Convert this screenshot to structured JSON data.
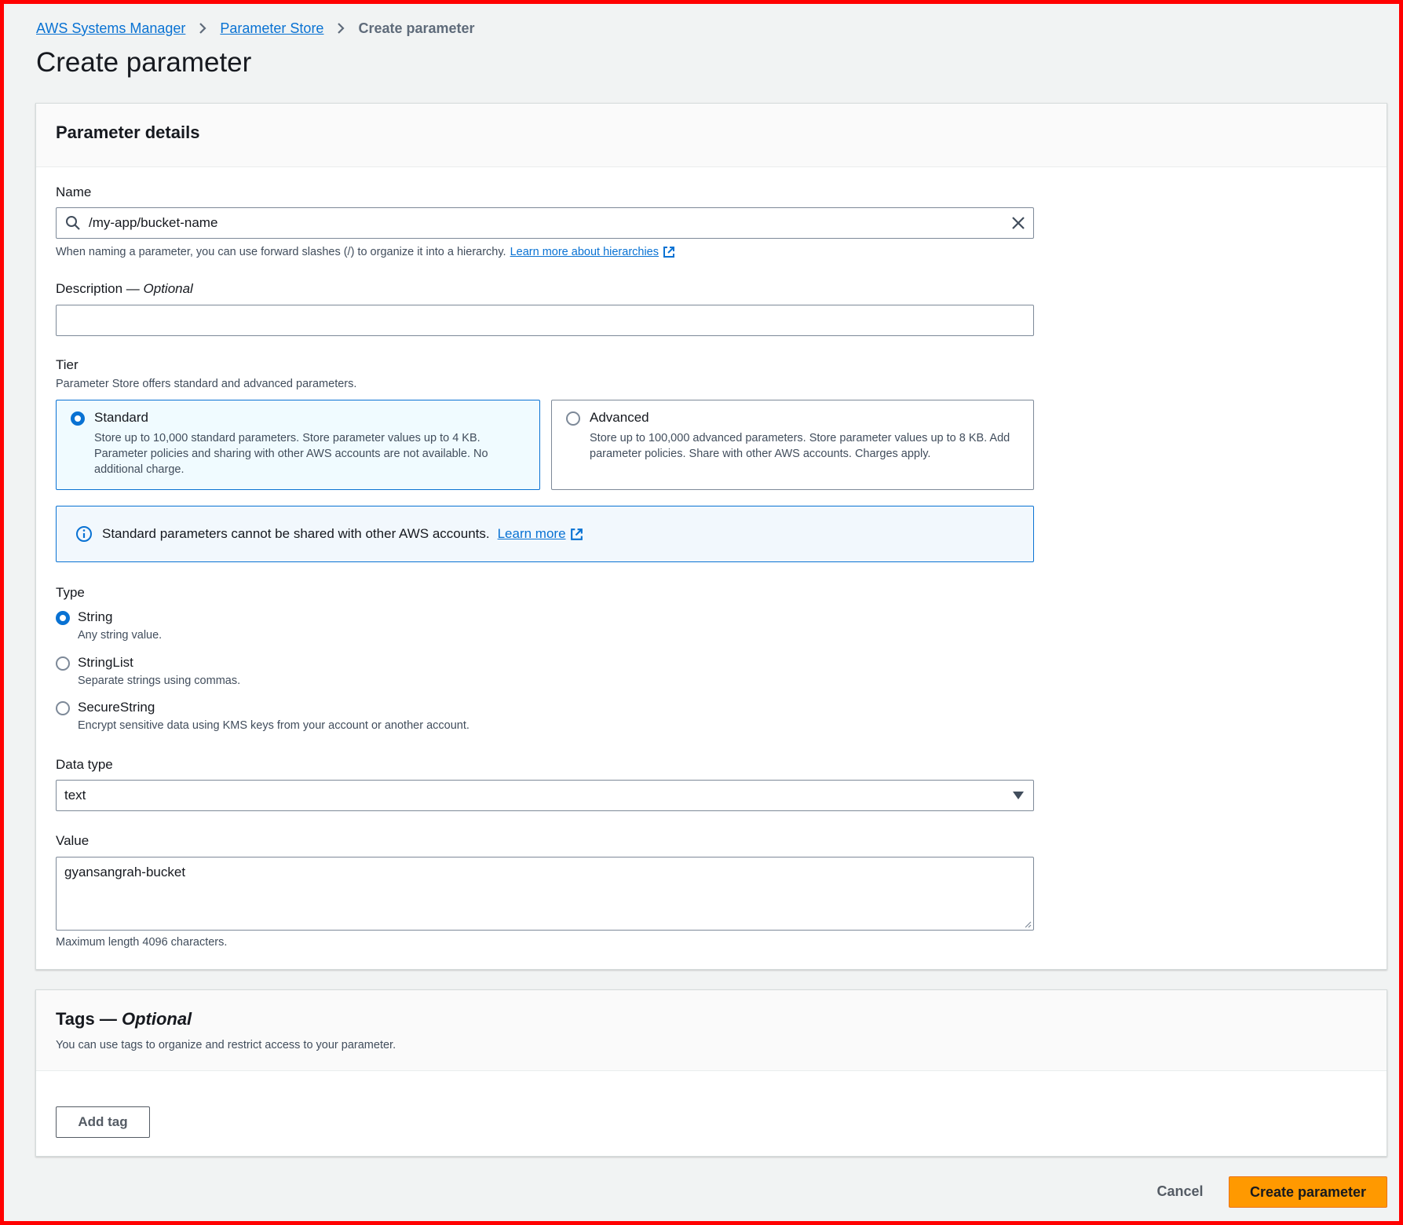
{
  "breadcrumb": {
    "items": [
      "AWS Systems Manager",
      "Parameter Store"
    ],
    "current": "Create parameter"
  },
  "page_title": "Create parameter",
  "details": {
    "title": "Parameter details",
    "name": {
      "label": "Name",
      "value": "/my-app/bucket-name",
      "hint": "When naming a parameter, you can use forward slashes (/) to organize it into a hierarchy.",
      "hint_link": "Learn more about hierarchies"
    },
    "description": {
      "label": "Description",
      "label_optional": "Optional",
      "value": ""
    },
    "tier": {
      "label": "Tier",
      "hint": "Parameter Store offers standard and advanced parameters.",
      "options": [
        {
          "title": "Standard",
          "desc": "Store up to 10,000 standard parameters. Store parameter values up to 4 KB. Parameter policies and sharing with other AWS accounts are not available. No additional charge.",
          "selected": true
        },
        {
          "title": "Advanced",
          "desc": "Store up to 100,000 advanced parameters. Store parameter values up to 8 KB. Add parameter policies. Share with other AWS accounts. Charges apply.",
          "selected": false
        }
      ]
    },
    "alert": {
      "text": "Standard parameters cannot be shared with other AWS accounts.",
      "link": "Learn more"
    },
    "type": {
      "label": "Type",
      "options": [
        {
          "title": "String",
          "desc": "Any string value.",
          "selected": true
        },
        {
          "title": "StringList",
          "desc": "Separate strings using commas.",
          "selected": false
        },
        {
          "title": "SecureString",
          "desc": "Encrypt sensitive data using KMS keys from your account or another account.",
          "selected": false
        }
      ]
    },
    "data_type": {
      "label": "Data type",
      "value": "text"
    },
    "value": {
      "label": "Value",
      "value": "gyansangrah-bucket",
      "hint": "Maximum length 4096 characters."
    }
  },
  "tags": {
    "title": "Tags",
    "title_optional": "Optional",
    "hint": "You can use tags to organize and restrict access to your parameter.",
    "add_button": "Add tag"
  },
  "actions": {
    "cancel": "Cancel",
    "submit": "Create parameter"
  },
  "colors": {
    "primary": "#ff9900",
    "link": "#0972d3",
    "alert_bg": "#f2f8fd"
  }
}
